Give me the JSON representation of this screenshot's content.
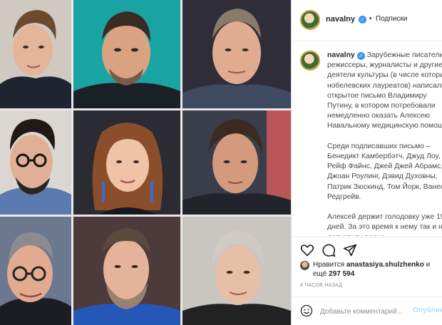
{
  "header": {
    "username": "navalny",
    "separator": "•",
    "follow_label": "Подписки",
    "verified_icon": "verified-check-icon"
  },
  "caption": {
    "username": "navalny",
    "text": " Зарубежные писатели,\nрежиссеры, журналисты и другие\nдеятели культуры (в числе которых\nнобелевских лауреатов) написали\nоткрытое письмо Владимиру\nПутину, в котором потребовали\nнемедленно оказать Алексею\nНавальному медицинскую помощь.\n\nСреди подписавших письмо –\nБенедикт Камбербэтч, Джуд Лоу,\nРейф Файнс, Джей Джей Абрамс,\nДжоан Роулинг, Дэвид Духовны,\nПатрик Зюскинд, Том Йорк, Ванесса\nРедгрейв.\n\nАлексей держит голодовку уже 19\nдней. За это время к нему так и не\nдопустили врача."
  },
  "actions": {
    "like_icon": "heart-icon",
    "comment_icon": "comment-icon",
    "share_icon": "share-icon"
  },
  "likes": {
    "prefix": "Нравится ",
    "user": "anastasiya.shulzhenko",
    "connector": " и",
    "count_prefix": "ещё ",
    "count": "297 594"
  },
  "timestamp": "8 ЧАСОВ НАЗАД",
  "comment": {
    "placeholder": "Добавьте комментарий...",
    "post_label": "Опубликовать",
    "emoji_icon": "smile-icon"
  },
  "colors": {
    "verified": "#3897f0",
    "post_button": "#b2dffc",
    "muted": "#8e8e8e"
  }
}
